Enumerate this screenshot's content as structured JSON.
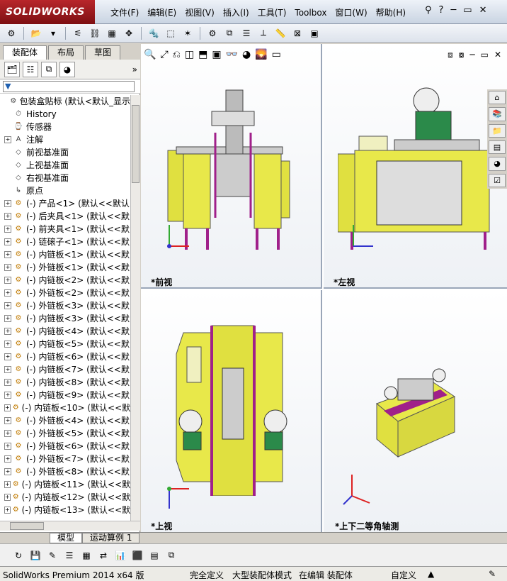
{
  "app": {
    "logo_text": "SOLIDWORKS",
    "brand_color": "#b8262b"
  },
  "menu": [
    "文件(F)",
    "编辑(E)",
    "视图(V)",
    "插入(I)",
    "工具(T)",
    "Toolbox",
    "窗口(W)",
    "帮助(H)"
  ],
  "tabs": [
    "装配体",
    "布局",
    "草图"
  ],
  "filter_placeholder": "",
  "tree": [
    {
      "label": "包装盒贴标 (默认<默认_显示",
      "level": 0,
      "exp": "",
      "icon": "asm-icon"
    },
    {
      "label": "History",
      "level": 1,
      "exp": "",
      "icon": "history-icon"
    },
    {
      "label": "传感器",
      "level": 1,
      "exp": "",
      "icon": "sensor-icon"
    },
    {
      "label": "注解",
      "level": 1,
      "exp": "+",
      "icon": "annotation-icon"
    },
    {
      "label": "前视基准面",
      "level": 1,
      "exp": "",
      "icon": "plane-icon"
    },
    {
      "label": "上视基准面",
      "level": 1,
      "exp": "",
      "icon": "plane-icon"
    },
    {
      "label": "右视基准面",
      "level": 1,
      "exp": "",
      "icon": "plane-icon"
    },
    {
      "label": "原点",
      "level": 1,
      "exp": "",
      "icon": "origin-icon"
    },
    {
      "label": "(-) 产品<1> (默认<<默认",
      "level": 1,
      "exp": "+",
      "icon": "part-icon"
    },
    {
      "label": "(-) 后夹具<1> (默认<<默",
      "level": 1,
      "exp": "+",
      "icon": "part-icon"
    },
    {
      "label": "(-) 前夹具<1> (默认<<默",
      "level": 1,
      "exp": "+",
      "icon": "part-icon"
    },
    {
      "label": "(-) 链磙子<1> (默认<<默",
      "level": 1,
      "exp": "+",
      "icon": "part-icon"
    },
    {
      "label": "(-) 内链板<1> (默认<<默",
      "level": 1,
      "exp": "+",
      "icon": "part-icon"
    },
    {
      "label": "(-) 外链板<1> (默认<<默",
      "level": 1,
      "exp": "+",
      "icon": "part-icon"
    },
    {
      "label": "(-) 内链板<2> (默认<<默",
      "level": 1,
      "exp": "+",
      "icon": "part-icon"
    },
    {
      "label": "(-) 外链板<2> (默认<<默",
      "level": 1,
      "exp": "+",
      "icon": "part-icon"
    },
    {
      "label": "(-) 外链板<3> (默认<<默",
      "level": 1,
      "exp": "+",
      "icon": "part-icon"
    },
    {
      "label": "(-) 内链板<3> (默认<<默",
      "level": 1,
      "exp": "+",
      "icon": "part-icon"
    },
    {
      "label": "(-) 内链板<4> (默认<<默",
      "level": 1,
      "exp": "+",
      "icon": "part-icon"
    },
    {
      "label": "(-) 内链板<5> (默认<<默",
      "level": 1,
      "exp": "+",
      "icon": "part-icon"
    },
    {
      "label": "(-) 内链板<6> (默认<<默",
      "level": 1,
      "exp": "+",
      "icon": "part-icon"
    },
    {
      "label": "(-) 内链板<7> (默认<<默",
      "level": 1,
      "exp": "+",
      "icon": "part-icon"
    },
    {
      "label": "(-) 内链板<8> (默认<<默",
      "level": 1,
      "exp": "+",
      "icon": "part-icon"
    },
    {
      "label": "(-) 内链板<9> (默认<<默",
      "level": 1,
      "exp": "+",
      "icon": "part-icon"
    },
    {
      "label": "(-) 内链板<10> (默认<<默",
      "level": 1,
      "exp": "+",
      "icon": "part-icon"
    },
    {
      "label": "(-) 外链板<4> (默认<<默",
      "level": 1,
      "exp": "+",
      "icon": "part-icon"
    },
    {
      "label": "(-) 外链板<5> (默认<<默",
      "level": 1,
      "exp": "+",
      "icon": "part-icon"
    },
    {
      "label": "(-) 外链板<6> (默认<<默",
      "level": 1,
      "exp": "+",
      "icon": "part-icon"
    },
    {
      "label": "(-) 外链板<7> (默认<<默",
      "level": 1,
      "exp": "+",
      "icon": "part-icon"
    },
    {
      "label": "(-) 外链板<8> (默认<<默",
      "level": 1,
      "exp": "+",
      "icon": "part-icon"
    },
    {
      "label": "(-) 内链板<11> (默认<<默",
      "level": 1,
      "exp": "+",
      "icon": "part-icon"
    },
    {
      "label": "(-) 内链板<12> (默认<<默",
      "level": 1,
      "exp": "+",
      "icon": "part-icon"
    },
    {
      "label": "(-) 内链板<13> (默认<<默",
      "level": 1,
      "exp": "+",
      "icon": "part-icon"
    }
  ],
  "views": {
    "front": "*前视",
    "left": "*左视",
    "top": "*上视",
    "iso": "*上下二等角轴测"
  },
  "bottom_tabs": [
    "模型",
    "运动算例 1"
  ],
  "status": {
    "product": "SolidWorks Premium 2014 x64 版",
    "s1": "完全定义",
    "s2": "大型装配体模式",
    "s3": "在编辑 装配体",
    "s4": "自定义",
    "s4_arrow": "▲"
  },
  "colors": {
    "machine": "#e8e84a",
    "frame": "#a0208a",
    "accent": "#4a7de0"
  }
}
